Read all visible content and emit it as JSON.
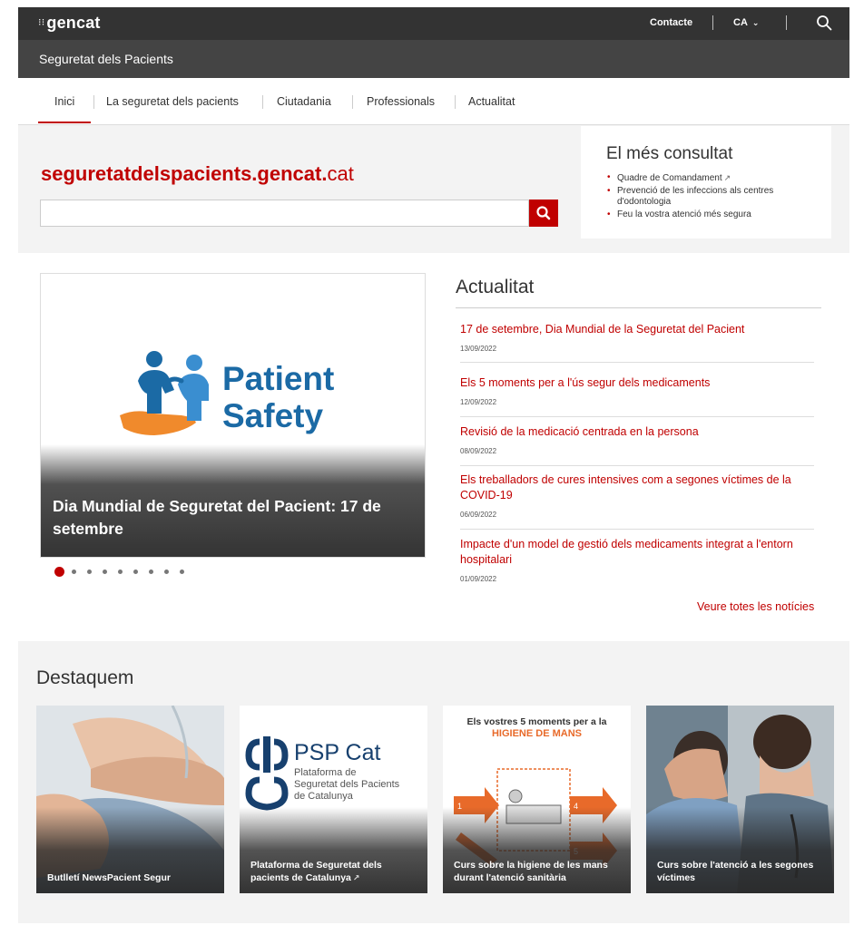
{
  "header": {
    "logo": "gencat",
    "contact_label": "Contacte",
    "language_label": "CA",
    "search_icon": "search-icon"
  },
  "site": {
    "title": "Seguretat dels Pacients"
  },
  "nav": {
    "items": [
      {
        "label": "Inici"
      },
      {
        "label": "La seguretat dels pacients"
      },
      {
        "label": "Ciutadania"
      },
      {
        "label": "Professionals"
      },
      {
        "label": "Actualitat"
      }
    ]
  },
  "hero": {
    "brand_main": "seguretatdelspacients.gencat.",
    "brand_suffix": "cat",
    "search_value": "",
    "search_icon": "search-icon"
  },
  "most_consulted": {
    "title": "El més consultat",
    "items": [
      {
        "label": "Quadre de Comandament",
        "external": true
      },
      {
        "label": "Prevenció de les infeccions als centres d'odontologia"
      },
      {
        "label": "Feu la vostra atenció més segura"
      }
    ]
  },
  "carousel": {
    "logo_line1": "Patient",
    "logo_line2": "Safety",
    "caption": "Dia Mundial de Seguretat del Pacient: 17 de setembre",
    "slide_count": 9,
    "active_index": 0
  },
  "news": {
    "title": "Actualitat",
    "items": [
      {
        "title": "17 de setembre, Dia Mundial de la Seguretat del Pacient",
        "date": "13/09/2022"
      },
      {
        "title": "Els 5 moments per a l'ús segur dels medicaments",
        "date": "12/09/2022"
      },
      {
        "title": "Revisió de la medicació centrada en la persona",
        "date": "08/09/2022"
      },
      {
        "title": "Els treballadors de cures intensives com a segones víctimes de la COVID-19",
        "date": "06/09/2022"
      },
      {
        "title": "Impacte d'un model de gestió dels medicaments integrat a l'entorn hospitalari",
        "date": "01/09/2022"
      }
    ],
    "see_all": "Veure totes les notícies"
  },
  "featured": {
    "title": "Destaquem",
    "cards": [
      {
        "label": "Butlletí NewsPacient Segur"
      },
      {
        "label": "Plataforma de Seguretat dels pacients de Catalunya",
        "external": true,
        "logo_title": "PSP Cat",
        "logo_line1": "Plataforma de",
        "logo_line2": "Seguretat dels Pacients",
        "logo_line3": "de Catalunya"
      },
      {
        "label": "Curs sobre la higiene de les mans durant l'atenció sanitària",
        "poster_line1": "Els vostres 5 moments per a la",
        "poster_line2": "HIGIENE DE MANS"
      },
      {
        "label": "Curs sobre l'atenció a les segones víctimes"
      }
    ]
  },
  "colors": {
    "brand_red": "#c00000",
    "topbar": "#333333",
    "sitebar": "#444444",
    "patient_blue": "#1b6aa5",
    "patient_orange": "#f08a2c"
  }
}
